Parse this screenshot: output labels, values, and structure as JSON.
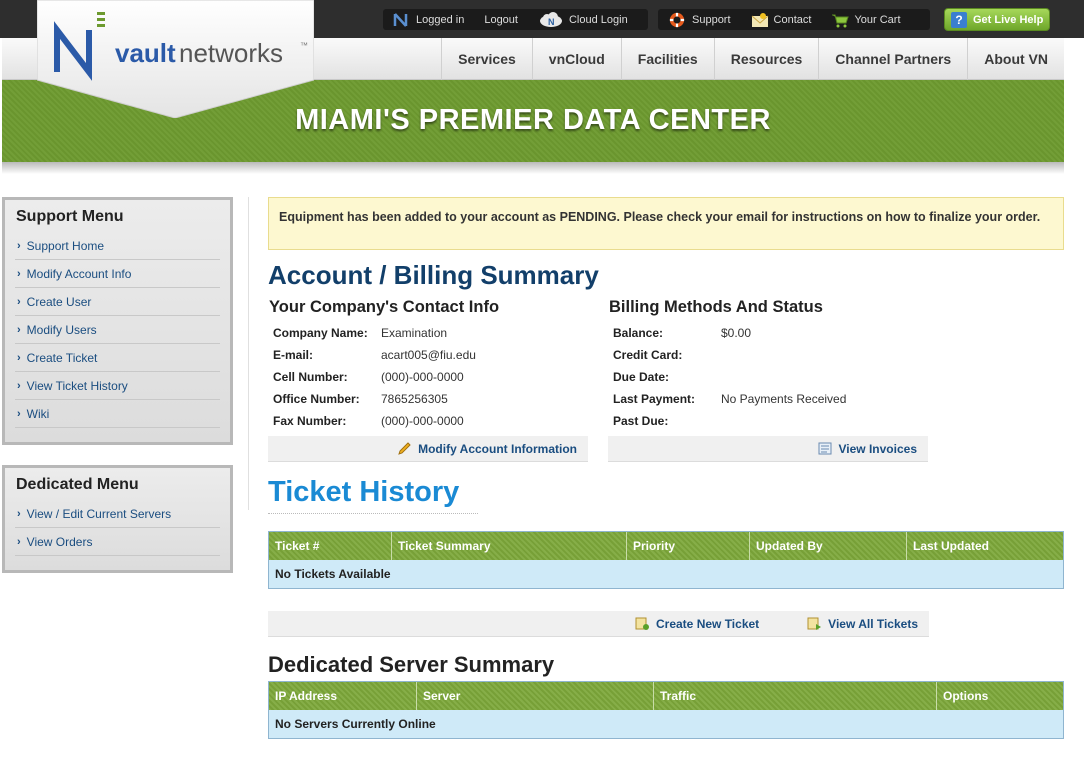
{
  "topbar": {
    "logged_in": "Logged in",
    "logout": "Logout",
    "cloud_login": "Cloud Login",
    "support": "Support",
    "contact": "Contact",
    "your_cart": "Your Cart",
    "live_help": "Get Live Help"
  },
  "logo": {
    "brand_bold": "vault",
    "brand_rest": "networks",
    "tm": "™"
  },
  "nav": {
    "items": [
      "Services",
      "vnCloud",
      "Facilities",
      "Resources",
      "Channel Partners",
      "About VN"
    ]
  },
  "banner": {
    "title": "MIAMI'S PREMIER DATA CENTER"
  },
  "support_menu": {
    "title": "Support Menu",
    "items": [
      "Support Home",
      "Modify Account Info",
      "Create User",
      "Modify Users",
      "Create Ticket",
      "View Ticket History",
      "Wiki"
    ]
  },
  "dedicated_menu": {
    "title": "Dedicated Menu",
    "items": [
      "View / Edit Current Servers",
      "View Orders"
    ]
  },
  "alert": {
    "text": "Equipment has been added to your account as PENDING. Please check your email for instructions on how to finalize your order."
  },
  "account": {
    "title": "Account / Billing Summary",
    "contact_title": "Your Company's Contact Info",
    "contact": [
      {
        "label": "Company Name:",
        "value": "Examination"
      },
      {
        "label": "E-mail:",
        "value": "acart005@fiu.edu"
      },
      {
        "label": "Cell Number:",
        "value": "(000)-000-0000"
      },
      {
        "label": "Office Number:",
        "value": "7865256305"
      },
      {
        "label": "Fax Number:",
        "value": "(000)-000-0000"
      }
    ],
    "modify_link": "Modify Account Information",
    "billing_title": "Billing Methods And Status",
    "billing": [
      {
        "label": "Balance:",
        "value": "$0.00"
      },
      {
        "label": "Credit Card:",
        "value": ""
      },
      {
        "label": "Due Date:",
        "value": ""
      },
      {
        "label": "Last Payment:",
        "value": "No Payments Received"
      },
      {
        "label": "Past Due:",
        "value": ""
      }
    ],
    "invoices_link": "View Invoices"
  },
  "tickets": {
    "title": "Ticket History",
    "columns": [
      "Ticket #",
      "Ticket Summary",
      "Priority",
      "Updated By",
      "Last Updated"
    ],
    "empty": "No Tickets Available",
    "create_link": "Create New Ticket",
    "view_all_link": "View All Tickets"
  },
  "servers": {
    "title": "Dedicated Server Summary",
    "columns": [
      "IP Address",
      "Server",
      "Traffic",
      "Options"
    ],
    "empty": "No Servers Currently Online"
  },
  "colors": {
    "brand_green": "#6d9a2f",
    "brand_blue": "#1a4d80",
    "ticket_title": "#1a8ad4"
  }
}
